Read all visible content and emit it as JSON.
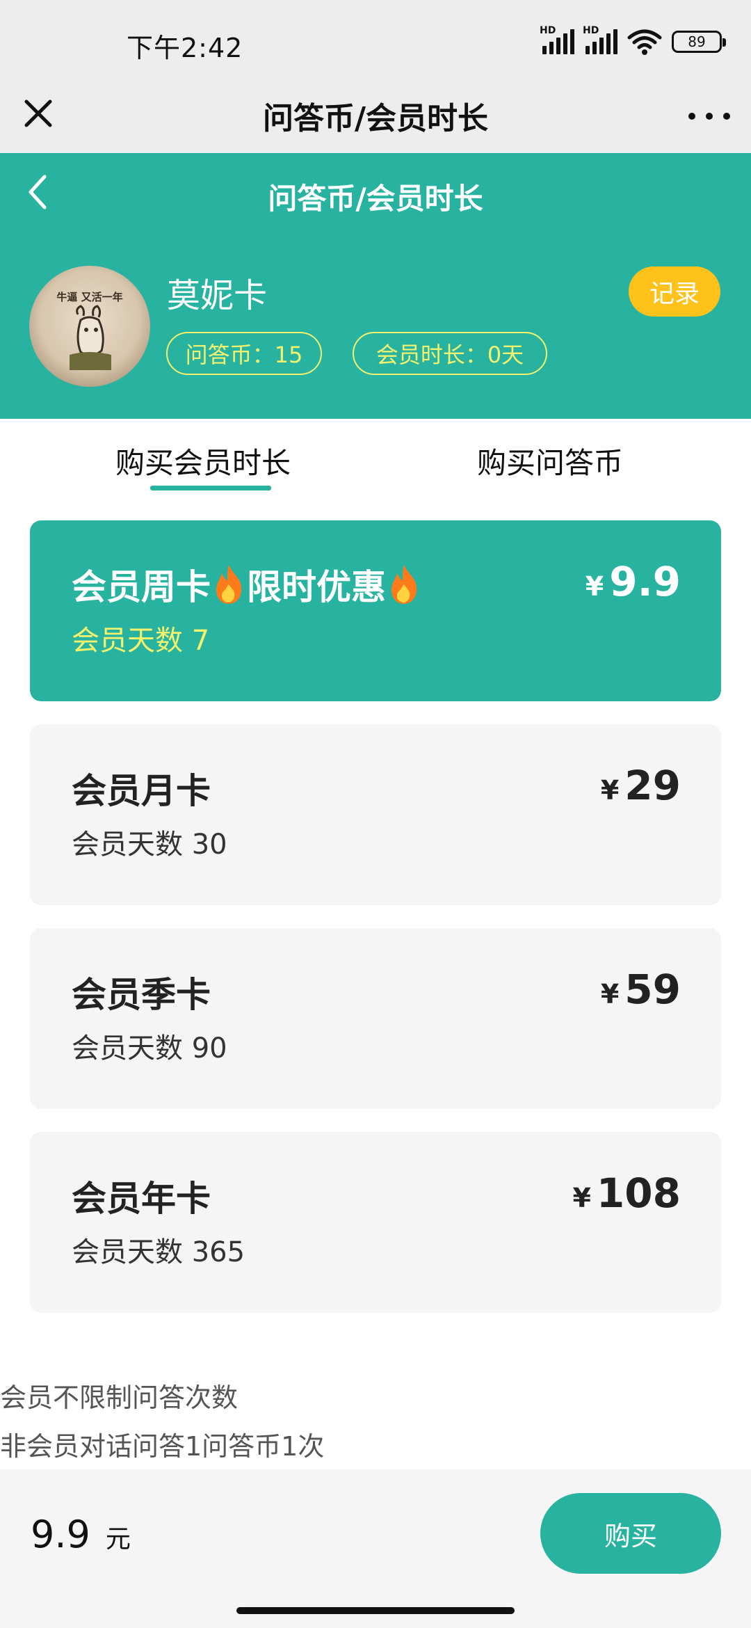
{
  "status_bar": {
    "time": "下午2:42",
    "hd_label": "HD",
    "battery": "89"
  },
  "app_bar": {
    "title": "问答币/会员时长"
  },
  "header": {
    "title": "问答币/会员时长",
    "username": "莫妮卡",
    "avatar_caption": "牛逼 又活一年",
    "record_label": "记录",
    "coins_label": "问答币：15",
    "days_label": "会员时长：0天",
    "accent_color": "#27b39f",
    "highlight_color": "#f3f26e",
    "record_color": "#ffc21a"
  },
  "tabs": {
    "member": "购买会员时长",
    "coins": "购买问答币",
    "active": "member"
  },
  "plans": [
    {
      "name": "会员周卡",
      "promo": "限时优惠",
      "days": "会员天数 7",
      "currency": "¥",
      "price": "9.9",
      "selected": true
    },
    {
      "name": "会员月卡",
      "days": "会员天数 30",
      "currency": "¥",
      "price": "29",
      "selected": false
    },
    {
      "name": "会员季卡",
      "days": "会员天数 90",
      "currency": "¥",
      "price": "59",
      "selected": false
    },
    {
      "name": "会员年卡",
      "days": "会员天数 365",
      "currency": "¥",
      "price": "108",
      "selected": false
    }
  ],
  "notes": [
    "会员不限制问答次数",
    "非会员对话问答1问答币1次"
  ],
  "bottom": {
    "amount": "9.9",
    "unit": "元",
    "buy_label": "购买"
  }
}
